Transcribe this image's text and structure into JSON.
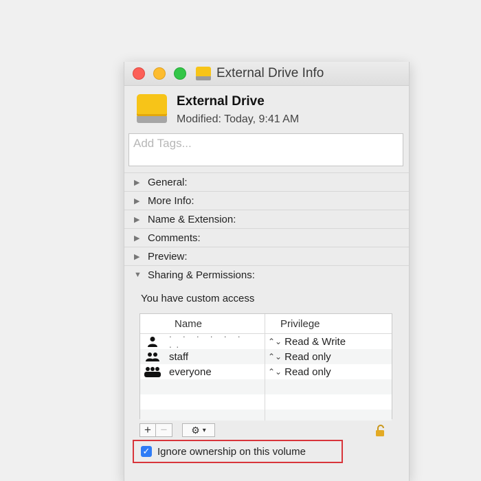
{
  "window": {
    "title": "External Drive Info"
  },
  "header": {
    "name": "External Drive",
    "modified": "Modified: Today, 9:41 AM"
  },
  "tags": {
    "placeholder": "Add Tags..."
  },
  "sections": [
    {
      "label": "General:",
      "expanded": false
    },
    {
      "label": "More Info:",
      "expanded": false
    },
    {
      "label": "Name & Extension:",
      "expanded": false
    },
    {
      "label": "Comments:",
      "expanded": false
    },
    {
      "label": "Preview:",
      "expanded": false
    },
    {
      "label": "Sharing & Permissions:",
      "expanded": true
    }
  ],
  "sharing": {
    "access_note": "You have custom access",
    "columns": {
      "name": "Name",
      "privilege": "Privilege"
    },
    "rows": [
      {
        "name": "",
        "privilege": "Read & Write",
        "icon": "user-icon"
      },
      {
        "name": "staff",
        "privilege": "Read only",
        "icon": "group-icon"
      },
      {
        "name": "everyone",
        "privilege": "Read only",
        "icon": "everyone-icon"
      }
    ]
  },
  "toolbar": {
    "add": "+",
    "remove": "−"
  },
  "ignore_ownership": {
    "label": "Ignore ownership on this volume",
    "checked": true
  },
  "colors": {
    "highlight_border": "#d8343a",
    "checkbox": "#2f7cf6",
    "drive": "#f7c418"
  }
}
